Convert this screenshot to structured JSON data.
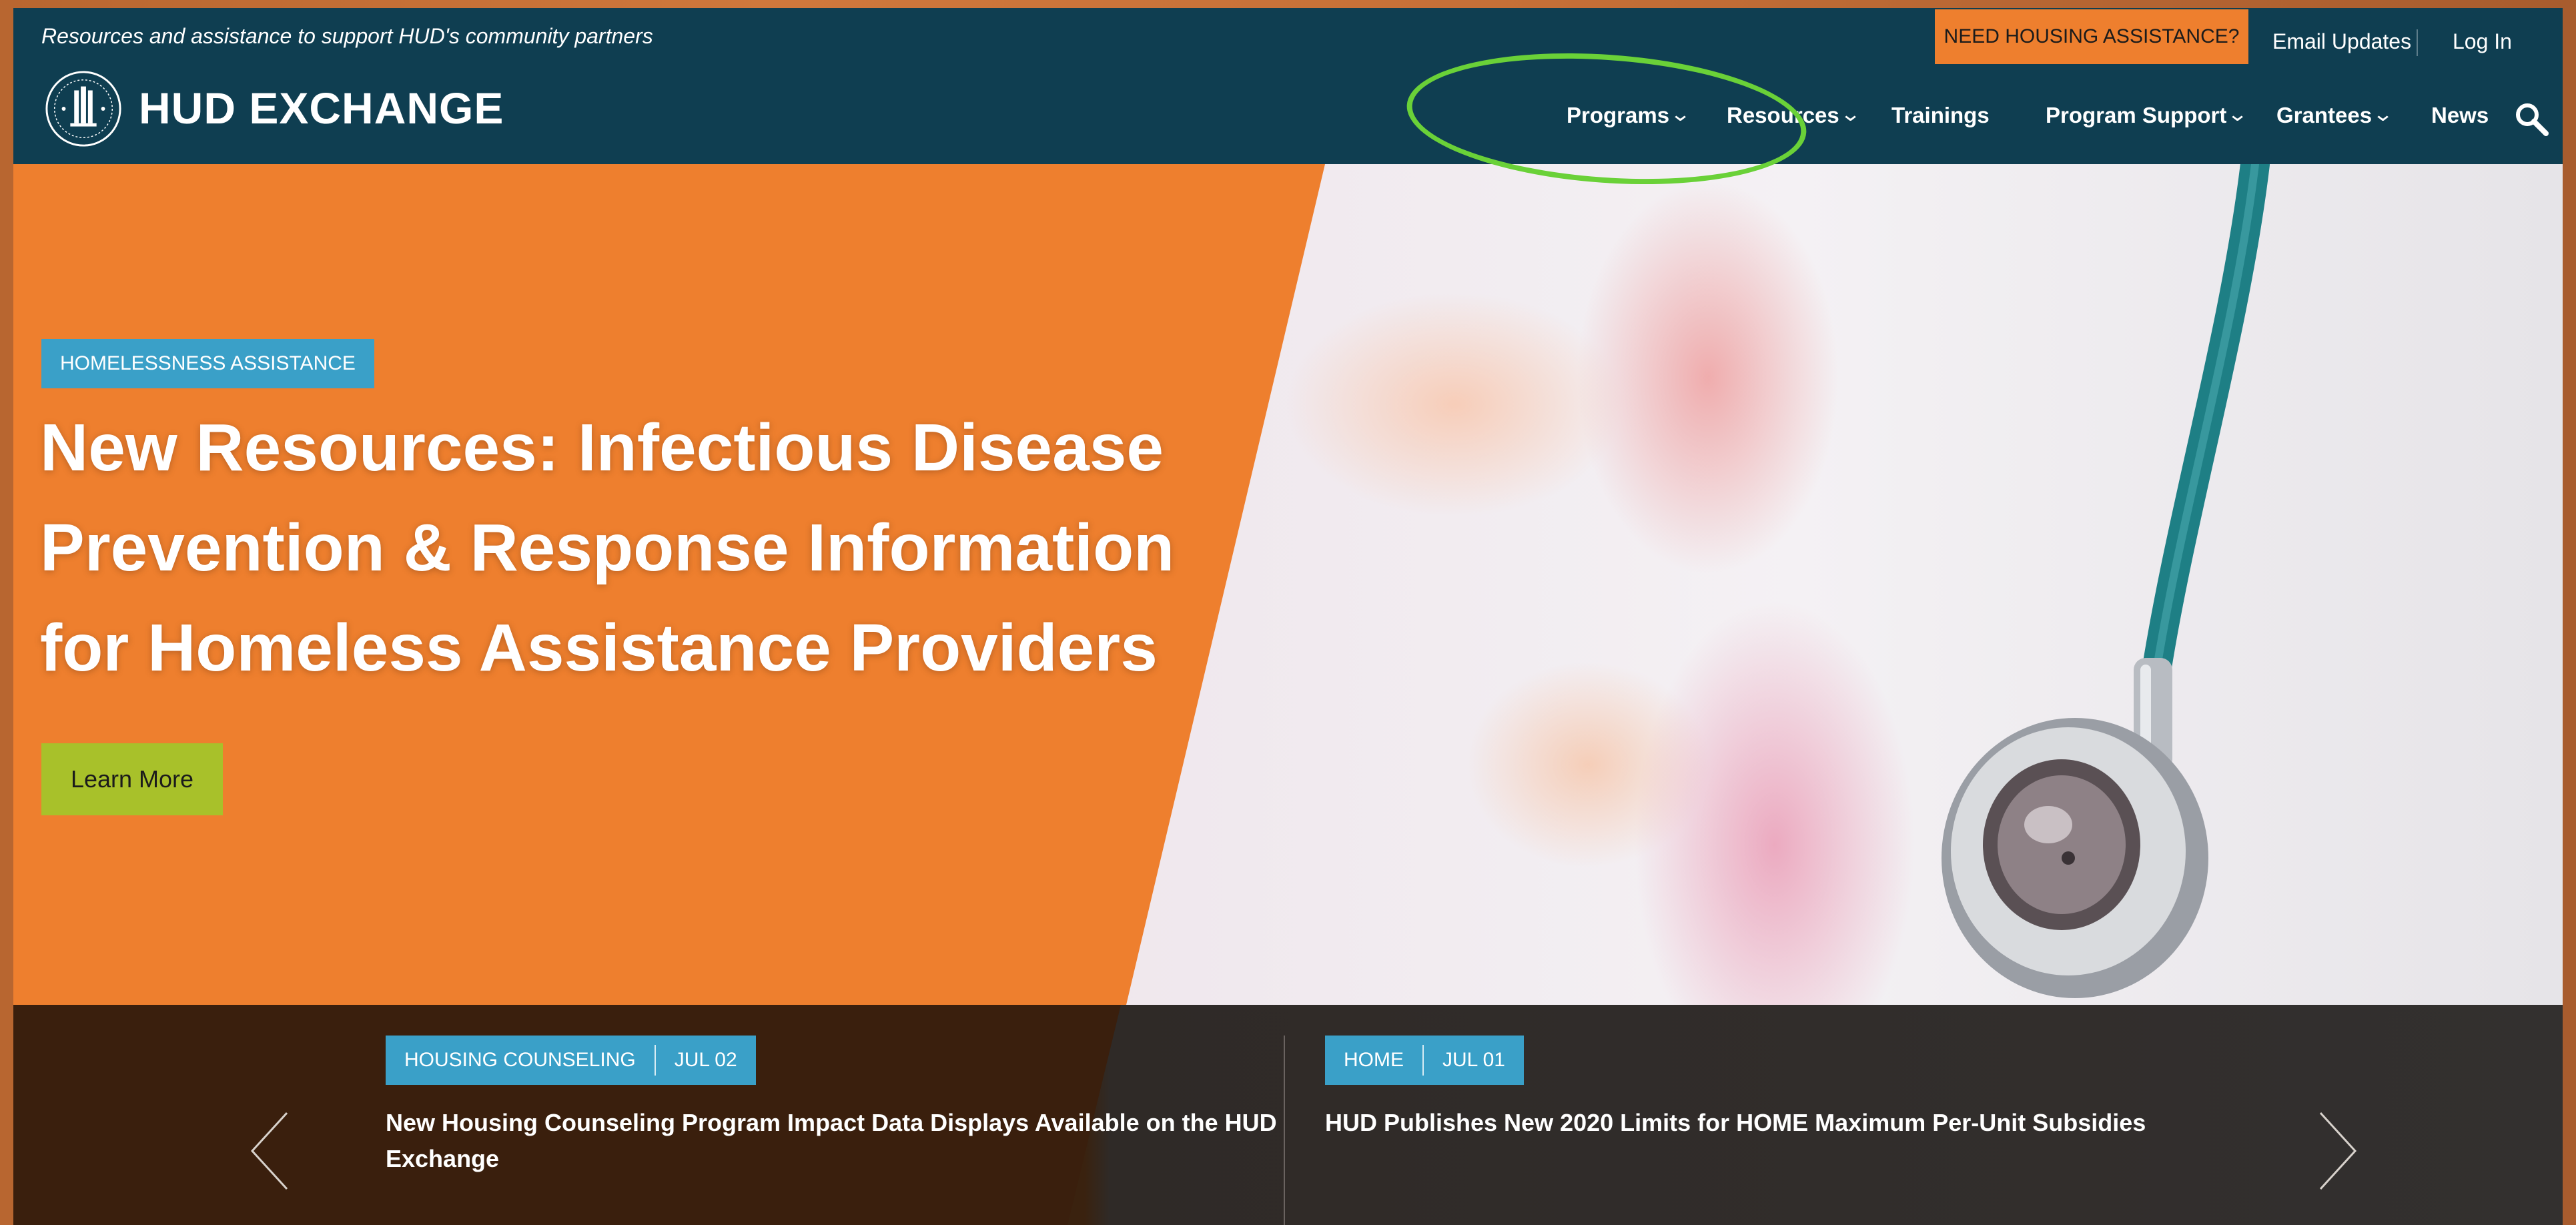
{
  "header": {
    "tagline": "Resources and assistance to support HUD's community partners",
    "brand": "HUD EXCHANGE",
    "need_assistance": "NEED HOUSING ASSISTANCE?",
    "email_updates": "Email Updates",
    "log_in": "Log In",
    "nav": [
      {
        "label": "Programs",
        "has_dropdown": true
      },
      {
        "label": "Resources",
        "has_dropdown": true
      },
      {
        "label": "Trainings",
        "has_dropdown": false
      },
      {
        "label": "Program Support",
        "has_dropdown": true
      },
      {
        "label": "Grantees",
        "has_dropdown": true
      },
      {
        "label": "News",
        "has_dropdown": false
      }
    ],
    "chevron": "⌄"
  },
  "hero": {
    "category": "HOMELESSNESS ASSISTANCE",
    "title_lines": [
      "New Resources: Infectious Disease",
      "Prevention & Response Information",
      "for Homeless Assistance Providers"
    ],
    "button": "Learn More"
  },
  "news": [
    {
      "category": "HOUSING COUNSELING",
      "date": "JUL 02",
      "title_lines": [
        "New Housing Counseling Program Impact Data Displays Available on the HUD",
        "Exchange"
      ]
    },
    {
      "category": "HOME",
      "date": "JUL 01",
      "title_lines": [
        "HUD Publishes New 2020 Limits for HOME Maximum Per-Unit Subsidies"
      ]
    }
  ],
  "colors": {
    "header_bg": "#0f3e51",
    "accent_orange": "#ee7f2e",
    "badge_blue": "#3aa0c8",
    "button_green": "#a8c12a",
    "annotation_green": "#6ad138"
  },
  "icons": [
    "hud-seal-icon",
    "chevron-down-icon",
    "search-icon",
    "arrow-left-icon",
    "arrow-right-icon"
  ]
}
